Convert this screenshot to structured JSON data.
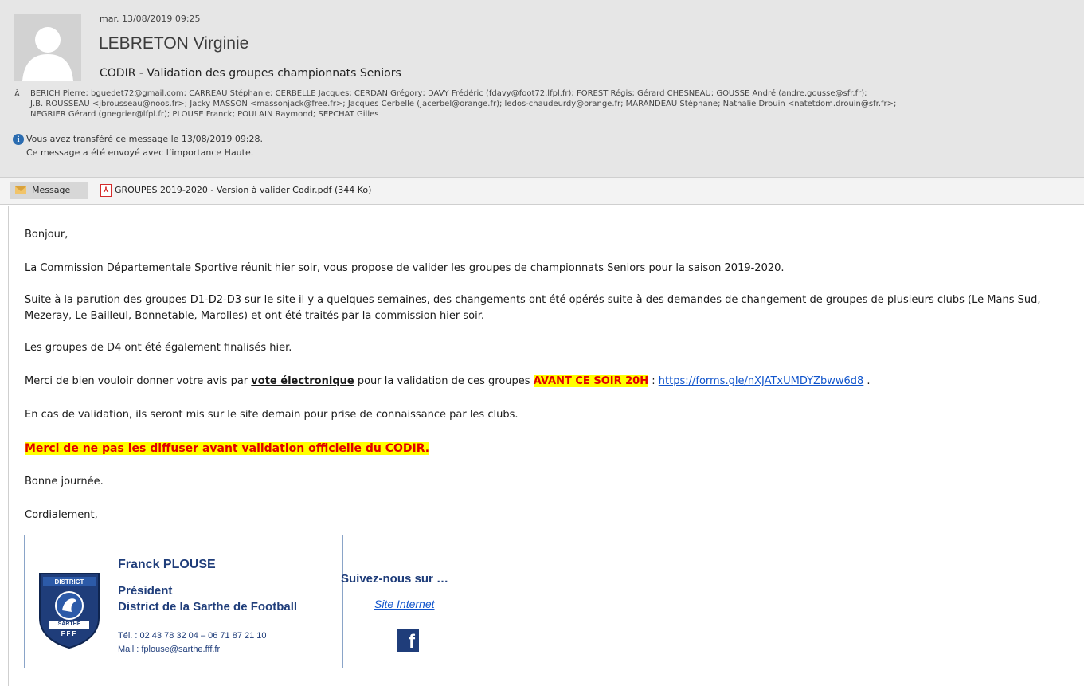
{
  "header": {
    "date": "mar. 13/08/2019 09:25",
    "sender": "LEBRETON Virginie",
    "subject": "CODIR - Validation des groupes championnats Seniors",
    "to_label": "À",
    "recipients_line1": "BERICH Pierre; bguedet72@gmail.com; CARREAU Stéphanie; CERBELLE Jacques; CERDAN Grégory; DAVY Frédéric (fdavy@foot72.lfpl.fr); FOREST Régis; Gérard CHESNEAU; GOUSSE André (andre.gousse@sfr.fr);",
    "recipients_line2": "J.B. ROUSSEAU <jbrousseau@noos.fr>; Jacky MASSON <massonjack@free.fr>; Jacques Cerbelle (jacerbel@orange.fr); ledos-chaudeurdy@orange.fr; MARANDEAU Stéphane; Nathalie Drouin <natetdom.drouin@sfr.fr>;",
    "recipients_line3": "NEGRIER Gérard (gnegrier@lfpl.fr); PLOUSE Franck; POULAIN Raymond; SEPCHAT Gilles",
    "info_line1": "Vous avez transféré ce message le 13/08/2019 09:28.",
    "info_line2": "Ce message a été envoyé avec l’importance Haute."
  },
  "attachments": {
    "message_tab": "Message",
    "file_name": "GROUPES 2019-2020 - Version à valider Codir.pdf (344 Ko)"
  },
  "body": {
    "greeting": "Bonjour,",
    "p1": "La Commission Départementale Sportive réunit hier soir, vous propose de valider les groupes de championnats Seniors pour la saison 2019-2020.",
    "p2": "Suite à la parution des groupes D1-D2-D3 sur le site il y a quelques semaines, des changements ont été opérés suite à des demandes de changement de groupes de plusieurs clubs (Le Mans Sud, Mezeray, Le Bailleul, Bonnetable, Marolles) et ont été traités par la commission hier soir.",
    "p3": "Les groupes de D4 ont été également finalisés hier.",
    "p4_start": "Merci de bien vouloir donner votre avis par ",
    "p4_vote": "vote électronique",
    "p4_mid": " pour la validation de ces groupes ",
    "p4_deadline": "AVANT CE SOIR 20H",
    "p4_sep": " : ",
    "p4_link": "https://forms.gle/nXJATxUMDYZbww6d8",
    "p4_end": " .",
    "p5": "En cas de validation, ils seront mis sur le site demain pour prise de connaissance par les clubs.",
    "warning": "Merci de ne pas les diffuser avant validation officielle du CODIR.",
    "p6": "Bonne journée.",
    "closing": "Cordialement,"
  },
  "signature": {
    "logo_text_top": "DISTRICT",
    "logo_text_bottom": "SARTHE",
    "logo_text_fff": "FFF",
    "name": "Franck PLOUSE",
    "role": "Président",
    "org": "District de la Sarthe de Football",
    "tel": "Tél. : 02 43 78 32 04 – 06 71 87 21 10",
    "mail_label": "Mail : ",
    "mail": "fplouse@sarthe.fff.fr",
    "follow": "Suivez-nous sur …",
    "site": "Site Internet",
    "fb_glyph": "f"
  }
}
